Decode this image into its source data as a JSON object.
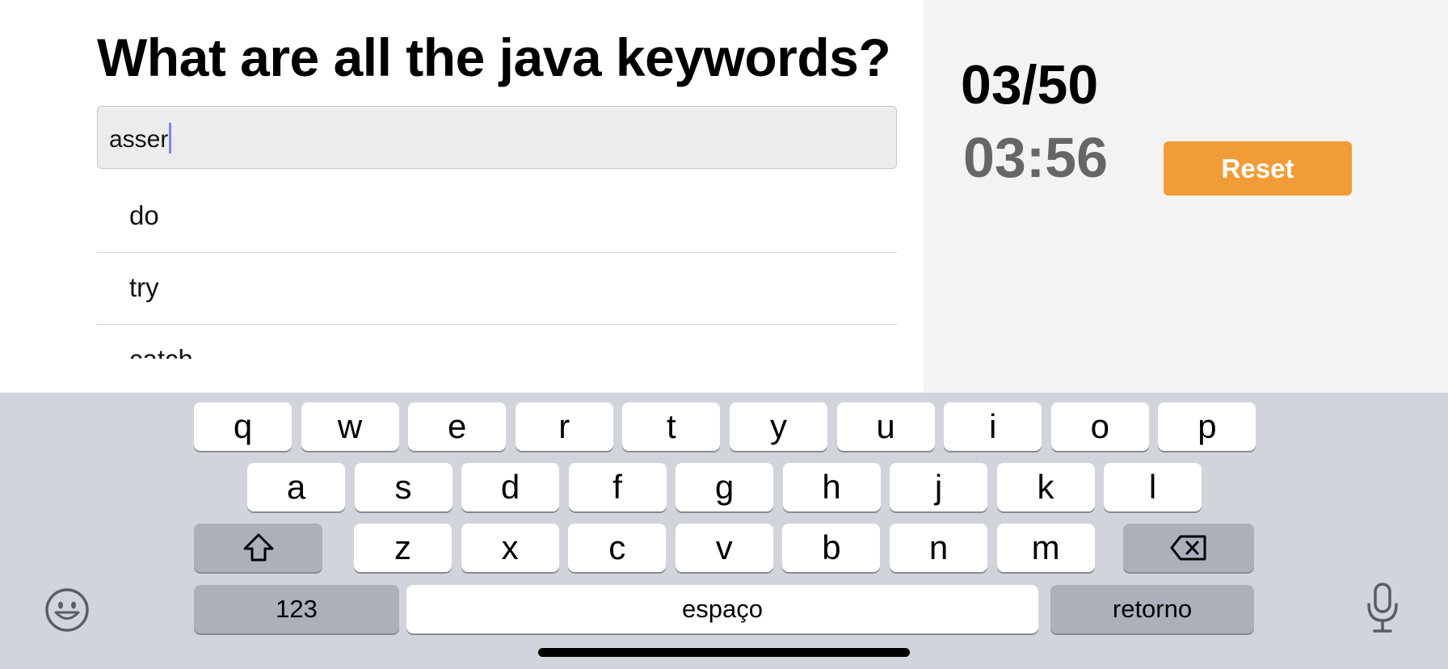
{
  "quiz": {
    "question": "What are all the java keywords?",
    "input_value": "asser",
    "answers": [
      "do",
      "try",
      "catch"
    ]
  },
  "status": {
    "score": "03/50",
    "timer": "03:56",
    "reset_label": "Reset",
    "reset_color": "#f29c38"
  },
  "keyboard": {
    "row1": [
      "q",
      "w",
      "e",
      "r",
      "t",
      "y",
      "u",
      "i",
      "o",
      "p"
    ],
    "row2": [
      "a",
      "s",
      "d",
      "f",
      "g",
      "h",
      "j",
      "k",
      "l"
    ],
    "row3": [
      "z",
      "x",
      "c",
      "v",
      "b",
      "n",
      "m"
    ],
    "numbers_label": "123",
    "space_label": "espaço",
    "return_label": "retorno",
    "icons": {
      "shift": "shift-icon",
      "backspace": "backspace-icon",
      "emoji": "emoji-icon",
      "mic": "microphone-icon"
    }
  }
}
